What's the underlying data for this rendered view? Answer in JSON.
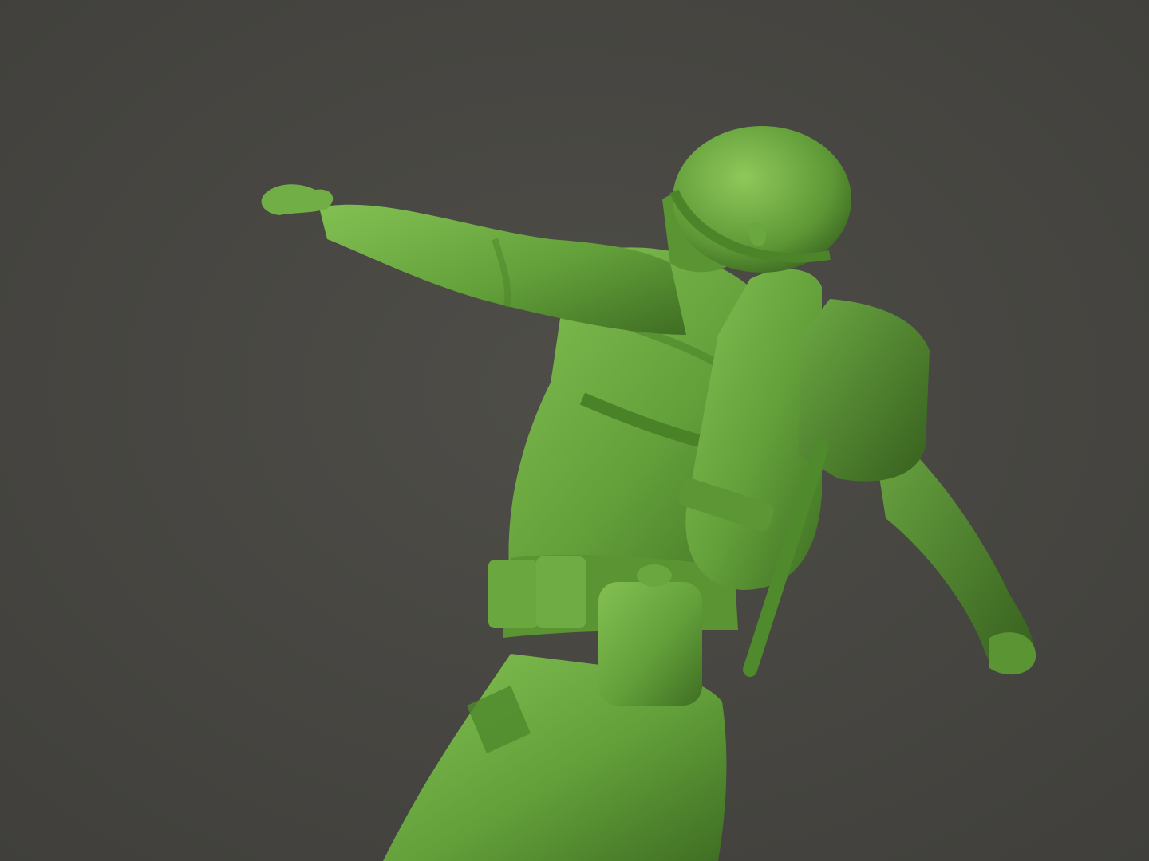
{
  "scene": {
    "subject": "toy-soldier-figure",
    "colors": {
      "background": "#4a4944",
      "plastic_base": "#5f9a38",
      "plastic_light": "#79b54a",
      "plastic_highlight": "#8fc95a",
      "plastic_shadow": "#3f6e23",
      "plastic_deep": "#2f561a"
    }
  }
}
